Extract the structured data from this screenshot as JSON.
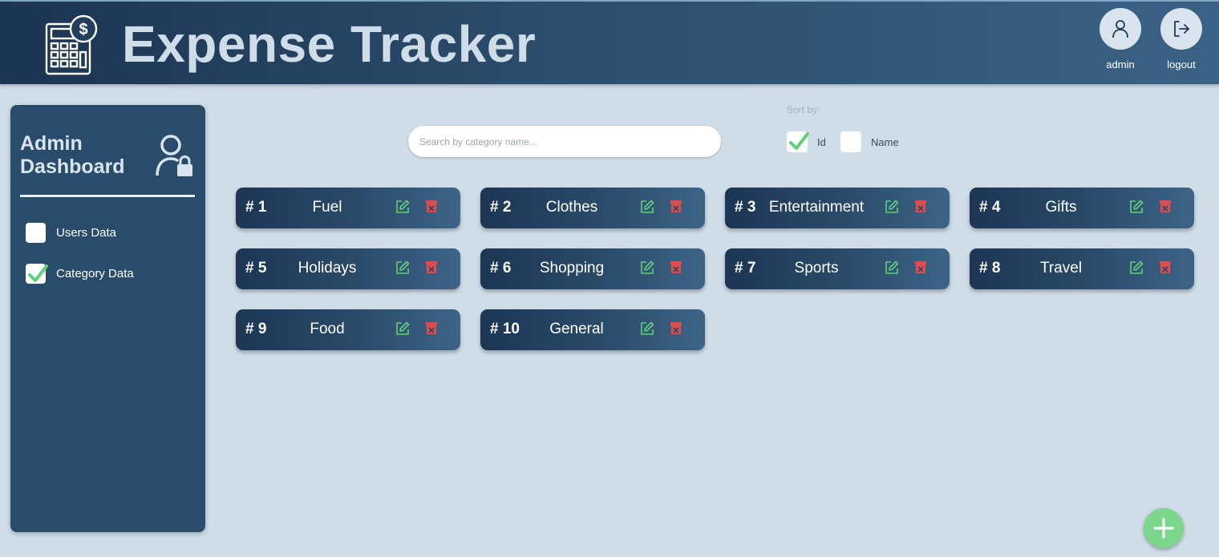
{
  "app": {
    "title": "Expense Tracker"
  },
  "header": {
    "admin_label": "admin",
    "logout_label": "logout"
  },
  "sidebar": {
    "title": "Admin Dashboard",
    "items": [
      {
        "label": "Users Data",
        "checked": false
      },
      {
        "label": "Category Data",
        "checked": true
      }
    ]
  },
  "search": {
    "placeholder": "Search by category name...",
    "value": ""
  },
  "sort": {
    "label": "Sort by:",
    "options": [
      {
        "label": "Id",
        "checked": true
      },
      {
        "label": "Name",
        "checked": false
      }
    ]
  },
  "categories": [
    {
      "num": "# 1",
      "name": "Fuel"
    },
    {
      "num": "# 2",
      "name": "Clothes"
    },
    {
      "num": "# 3",
      "name": "Entertainment"
    },
    {
      "num": "# 4",
      "name": "Gifts"
    },
    {
      "num": "# 5",
      "name": "Holidays"
    },
    {
      "num": "# 6",
      "name": "Shopping"
    },
    {
      "num": "# 7",
      "name": "Sports"
    },
    {
      "num": "# 8",
      "name": "Travel"
    },
    {
      "num": "# 9",
      "name": "Food"
    },
    {
      "num": "# 10",
      "name": "General"
    }
  ],
  "colors": {
    "accent_green": "#7cd68b",
    "delete_red": "#e04b4b",
    "edit_green": "#5fd07a",
    "header_bg": "#1b3552",
    "page_bg": "#cfdde9"
  },
  "icons": {
    "logo": "calculator-dollar-icon",
    "admin": "user-icon",
    "logout": "logout-icon",
    "sidebar": "user-lock-icon",
    "edit": "edit-icon",
    "delete": "trash-icon",
    "add": "plus-icon",
    "check": "checkmark-icon"
  }
}
